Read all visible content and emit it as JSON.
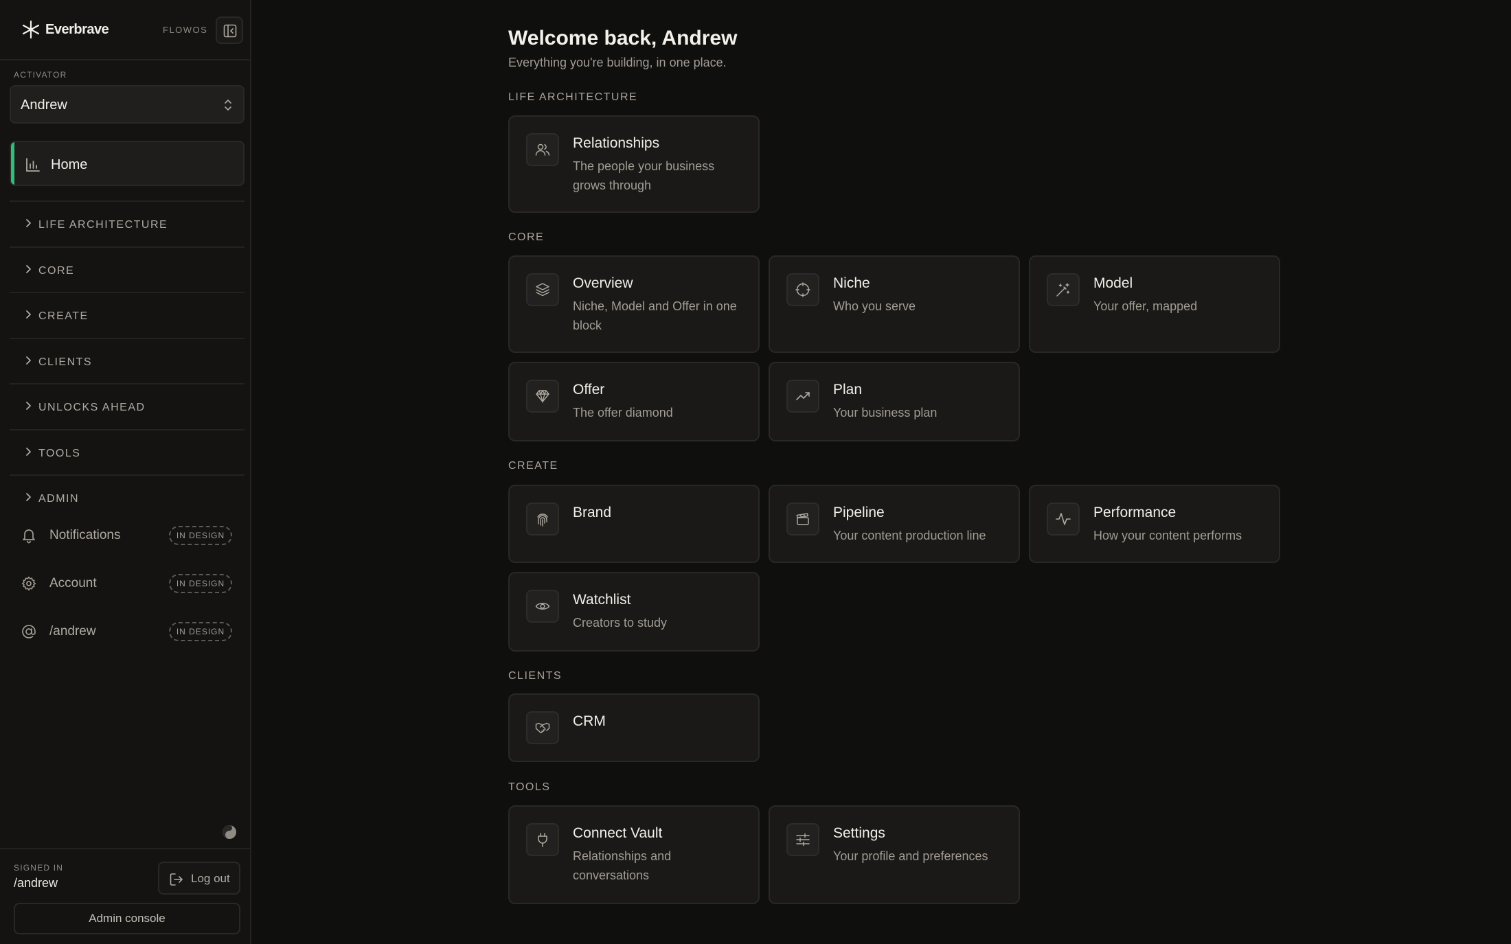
{
  "brand": {
    "name": "Everbrave",
    "product": "FLOWOS"
  },
  "activator": {
    "label": "ACTIVATOR",
    "value": "Andrew"
  },
  "nav": {
    "home": "Home",
    "sections": [
      "LIFE ARCHITECTURE",
      "CORE",
      "CREATE",
      "CLIENTS",
      "UNLOCKS AHEAD",
      "TOOLS",
      "ADMIN"
    ],
    "utilities": [
      {
        "label": "Notifications",
        "badge": "IN DESIGN"
      },
      {
        "label": "Account",
        "badge": "IN DESIGN"
      },
      {
        "label": "/andrew",
        "badge": "IN DESIGN"
      }
    ]
  },
  "footer": {
    "signed_in_label": "SIGNED IN",
    "user": "/andrew",
    "logout": "Log out",
    "admin_console": "Admin console"
  },
  "main": {
    "welcome": "Welcome back, Andrew",
    "subtitle": "Everything you're building, in one place.",
    "groups": {
      "life": {
        "label": "LIFE ARCHITECTURE",
        "cards": [
          {
            "title": "Relationships",
            "desc": "The people your business grows through",
            "icon": "users-icon"
          }
        ]
      },
      "core": {
        "label": "CORE",
        "cards": [
          {
            "title": "Overview",
            "desc": "Niche, Model and Offer in one block",
            "icon": "layers-icon"
          },
          {
            "title": "Niche",
            "desc": "Who you serve",
            "icon": "crosshair-icon"
          },
          {
            "title": "Model",
            "desc": "Your offer, mapped",
            "icon": "magic-wand-icon"
          },
          {
            "title": "Offer",
            "desc": "The offer diamond",
            "icon": "diamond-icon"
          },
          {
            "title": "Plan",
            "desc": "Your business plan",
            "icon": "trending-up-icon"
          }
        ]
      },
      "create": {
        "label": "CREATE",
        "cards": [
          {
            "title": "Brand",
            "desc": "",
            "icon": "fingerprint-icon"
          },
          {
            "title": "Pipeline",
            "desc": "Your content production line",
            "icon": "clapperboard-icon"
          },
          {
            "title": "Performance",
            "desc": "How your content performs",
            "icon": "activity-icon"
          },
          {
            "title": "Watchlist",
            "desc": "Creators to study",
            "icon": "eye-icon"
          }
        ]
      },
      "clients": {
        "label": "CLIENTS",
        "cards": [
          {
            "title": "CRM",
            "desc": "",
            "icon": "handshake-icon"
          }
        ]
      },
      "tools": {
        "label": "TOOLS",
        "cards": [
          {
            "title": "Connect Vault",
            "desc": "Relationships and conversations",
            "icon": "plug-icon"
          },
          {
            "title": "Settings",
            "desc": "Your profile and preferences",
            "icon": "sliders-icon"
          }
        ]
      }
    }
  },
  "colors": {
    "background": "#0f0f0e",
    "sidebar": "#141312",
    "card": "#1a1917",
    "accent": "#2fbf7a",
    "text": "#ece8e1",
    "muted": "#a29c93"
  }
}
